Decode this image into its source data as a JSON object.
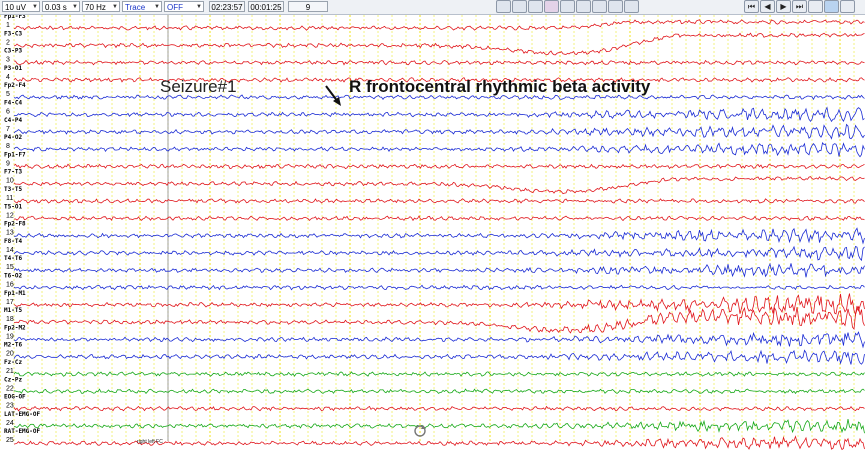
{
  "toolbar": {
    "sensitivity": "10 uV",
    "time_constant": "0.03 s",
    "filter": "70 Hz",
    "mode": "Trace",
    "notch": "OFF",
    "clock_time": "02:23:57",
    "elapsed": "00:01:25",
    "page": "9"
  },
  "annotations": {
    "seizure": "Seizure#1",
    "description": "R frontocentral rhythmic beta activity",
    "footer": "right left FC"
  },
  "colors": {
    "red": "#e0151b",
    "blue": "#1a2bd4",
    "green": "#16a817",
    "gridline": "#e6e600"
  },
  "channels": [
    {
      "num": "1",
      "label": "Fp1-F3",
      "color": "red"
    },
    {
      "num": "2",
      "label": "F3-C3",
      "color": "red"
    },
    {
      "num": "3",
      "label": "C3-P3",
      "color": "red"
    },
    {
      "num": "4",
      "label": "P3-O1",
      "color": "red"
    },
    {
      "num": "5",
      "label": "Fp2-F4",
      "color": "blue"
    },
    {
      "num": "6",
      "label": "F4-C4",
      "color": "blue"
    },
    {
      "num": "7",
      "label": "C4-P4",
      "color": "blue"
    },
    {
      "num": "8",
      "label": "P4-O2",
      "color": "blue"
    },
    {
      "num": "9",
      "label": "Fp1-F7",
      "color": "red"
    },
    {
      "num": "10",
      "label": "F7-T3",
      "color": "red"
    },
    {
      "num": "11",
      "label": "T3-T5",
      "color": "red"
    },
    {
      "num": "12",
      "label": "T5-O1",
      "color": "red"
    },
    {
      "num": "13",
      "label": "Fp2-F8",
      "color": "blue"
    },
    {
      "num": "14",
      "label": "F8-T4",
      "color": "blue"
    },
    {
      "num": "15",
      "label": "T4-T6",
      "color": "blue"
    },
    {
      "num": "16",
      "label": "T6-O2",
      "color": "blue"
    },
    {
      "num": "17",
      "label": "Fp1-M1",
      "color": "red"
    },
    {
      "num": "18",
      "label": "M1-T5",
      "color": "red"
    },
    {
      "num": "19",
      "label": "Fp2-M2",
      "color": "blue"
    },
    {
      "num": "20",
      "label": "M2-T6",
      "color": "blue"
    },
    {
      "num": "21",
      "label": "Fz-Cz",
      "color": "green"
    },
    {
      "num": "22",
      "label": "Cz-Pz",
      "color": "green"
    },
    {
      "num": "23",
      "label": "EOG-OF",
      "color": "red"
    },
    {
      "num": "24",
      "label": "LAT-EMG-OF",
      "color": "green"
    },
    {
      "num": "25",
      "label": "RAT-EMG-OF",
      "color": "red"
    }
  ]
}
